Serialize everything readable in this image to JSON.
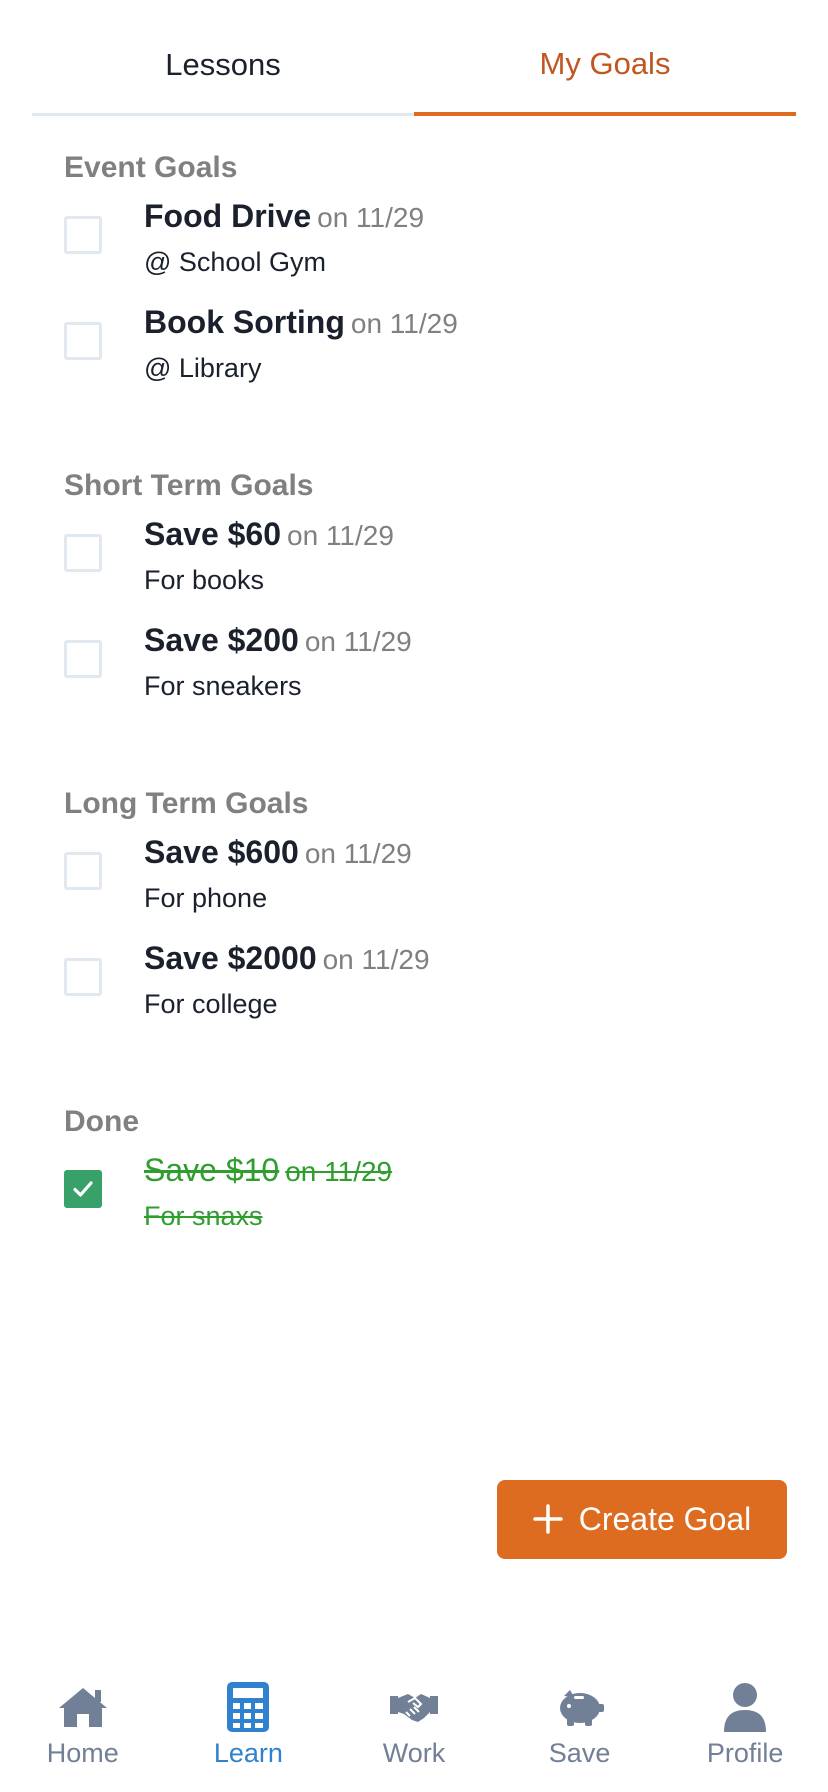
{
  "tabs": [
    {
      "label": "Lessons"
    },
    {
      "label": "My Goals"
    }
  ],
  "sections": [
    {
      "title": "Event Goals",
      "goals": [
        {
          "title": "Food Drive",
          "date": "on 11/29",
          "sub": "@ School Gym"
        },
        {
          "title": "Book Sorting",
          "date": "on 11/29",
          "sub": "@ Library"
        }
      ]
    },
    {
      "title": "Short Term Goals",
      "goals": [
        {
          "title": "Save $60",
          "date": "on 11/29",
          "sub": "For books"
        },
        {
          "title": "Save $200",
          "date": "on 11/29",
          "sub": "For sneakers"
        }
      ]
    },
    {
      "title": "Long Term Goals",
      "goals": [
        {
          "title": "Save $600",
          "date": "on 11/29",
          "sub": "For phone"
        },
        {
          "title": "Save $2000",
          "date": "on 11/29",
          "sub": "For college"
        }
      ]
    },
    {
      "title": "Done",
      "goals": [
        {
          "title": "Save $10",
          "date": "on 11/29",
          "sub": "For snaxs"
        }
      ]
    }
  ],
  "create_button": {
    "label": "Create Goal"
  },
  "nav": [
    {
      "label": "Home",
      "icon": "home-icon"
    },
    {
      "label": "Learn",
      "icon": "calculator-icon"
    },
    {
      "label": "Work",
      "icon": "handshake-icon"
    },
    {
      "label": "Save",
      "icon": "piggy-bank-icon"
    },
    {
      "label": "Profile",
      "icon": "user-icon"
    }
  ],
  "colors": {
    "accent": "#dd6b20",
    "active_nav": "#3182ce",
    "done": "#38a169"
  }
}
